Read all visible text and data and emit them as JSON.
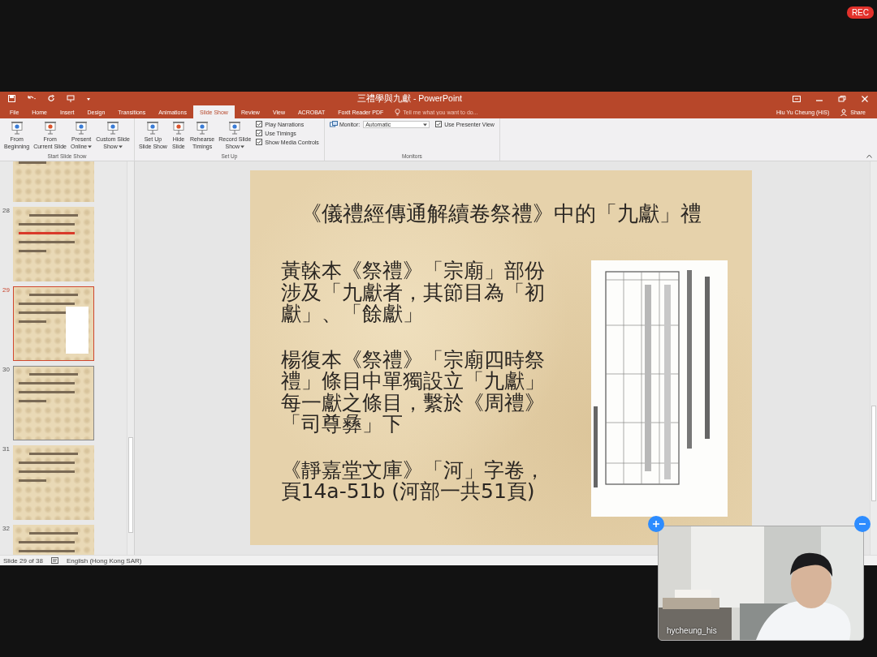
{
  "rec_badge": "REC",
  "window": {
    "title": "三禮學與九獻 - PowerPoint",
    "user": "Hiu Yu Cheung (HIS)",
    "share": "Share"
  },
  "tabs": [
    {
      "label": "File",
      "selected": false
    },
    {
      "label": "Home",
      "selected": false
    },
    {
      "label": "Insert",
      "selected": false
    },
    {
      "label": "Design",
      "selected": false
    },
    {
      "label": "Transitions",
      "selected": false
    },
    {
      "label": "Animations",
      "selected": false
    },
    {
      "label": "Slide Show",
      "selected": true
    },
    {
      "label": "Review",
      "selected": false
    },
    {
      "label": "View",
      "selected": false
    },
    {
      "label": "ACROBAT",
      "selected": false
    },
    {
      "label": "Foxit Reader PDF",
      "selected": false
    }
  ],
  "tell_me": {
    "placeholder": "Tell me what you want to do..."
  },
  "ribbon_groups": [
    {
      "label": "Start Slide Show",
      "items": [
        {
          "kind": "button",
          "lines": [
            "From",
            "Beginning"
          ],
          "dropdown": false
        },
        {
          "kind": "button",
          "lines": [
            "From",
            "Current Slide"
          ],
          "dropdown": false
        },
        {
          "kind": "button",
          "lines": [
            "Present",
            "Online"
          ],
          "dropdown": true
        },
        {
          "kind": "button",
          "lines": [
            "Custom Slide",
            "Show"
          ],
          "dropdown": true
        }
      ]
    },
    {
      "label": "Set Up",
      "items": [
        {
          "kind": "button",
          "lines": [
            "Set Up",
            "Slide Show"
          ],
          "dropdown": false
        },
        {
          "kind": "button",
          "lines": [
            "Hide",
            "Slide"
          ],
          "dropdown": false
        },
        {
          "kind": "button",
          "lines": [
            "Rehearse",
            "Timings"
          ],
          "dropdown": false
        },
        {
          "kind": "button",
          "lines": [
            "Record Slide",
            "Show"
          ],
          "dropdown": true
        },
        {
          "kind": "checks",
          "checks": [
            {
              "label": "Play Narrations",
              "checked": true
            },
            {
              "label": "Use Timings",
              "checked": true
            },
            {
              "label": "Show Media Controls",
              "checked": true
            }
          ]
        }
      ]
    },
    {
      "label": "Monitors",
      "items": [
        {
          "kind": "monitor",
          "label": "Monitor:",
          "value": "Automatic"
        },
        {
          "kind": "checks",
          "checks": [
            {
              "label": "Use Presenter View",
              "checked": true
            }
          ]
        }
      ]
    }
  ],
  "thumbnails": [
    {
      "selected": false,
      "hovered": false
    },
    {
      "number": "28",
      "selected": false,
      "hovered": false
    },
    {
      "number": "29",
      "selected": true,
      "hovered": false
    },
    {
      "number": "30",
      "selected": false,
      "hovered": true
    },
    {
      "number": "31",
      "selected": false,
      "hovered": false
    },
    {
      "number": "32",
      "selected": false,
      "hovered": false
    }
  ],
  "slide": {
    "title": "《儀禮經傳通解續卷祭禮》中的「九獻」禮",
    "paragraphs": [
      "黃榦本《祭禮》「宗廟」部份涉及「九獻者，其節目為「初獻」、「餘獻」",
      "楊復本《祭禮》「宗廟四時祭禮」條目中單獨設立「九獻」每一獻之條目，繫於《周禮》「司尊彝」下",
      "《靜嘉堂文庫》「河」字卷，頁14a-51b (河部一共51頁)"
    ],
    "image": {
      "kind": "picture"
    }
  },
  "status_bar": {
    "slide": "Slide 29 of 38",
    "language": "English (Hong Kong SAR)"
  },
  "video": {
    "name": "hycheung_his"
  }
}
